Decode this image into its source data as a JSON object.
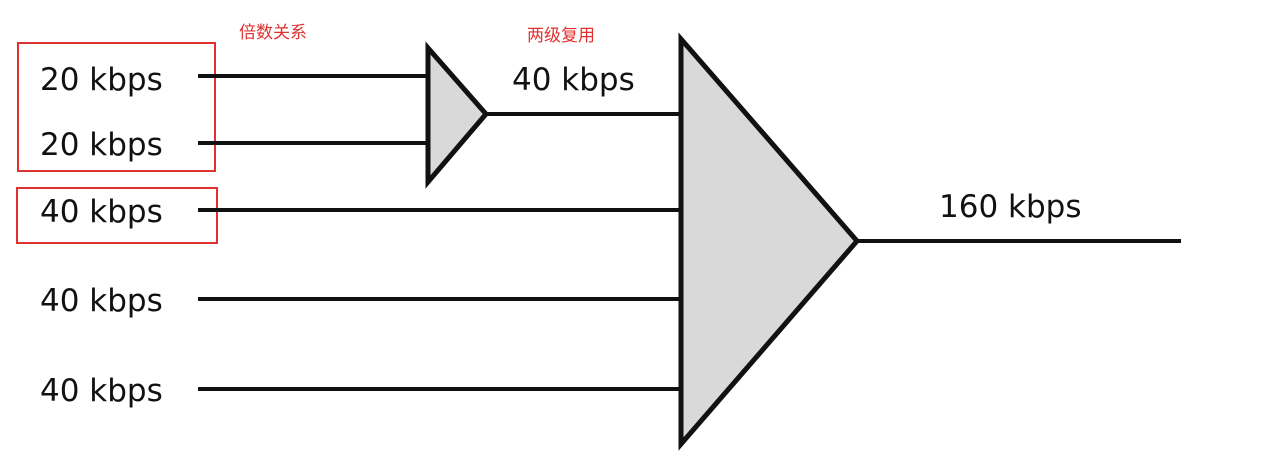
{
  "annotations": {
    "multiple_relation": "倍数关系",
    "two_level_multiplexing": "两级复用"
  },
  "inputs": [
    {
      "label": "20 kbps"
    },
    {
      "label": "20 kbps"
    },
    {
      "label": "40 kbps"
    },
    {
      "label": "40 kbps"
    },
    {
      "label": "40 kbps"
    }
  ],
  "intermediate": {
    "label": "40 kbps"
  },
  "output": {
    "label": "160 kbps"
  },
  "colors": {
    "line": "#111111",
    "mux_fill": "#d9d9d9",
    "highlight": "#e03131"
  }
}
